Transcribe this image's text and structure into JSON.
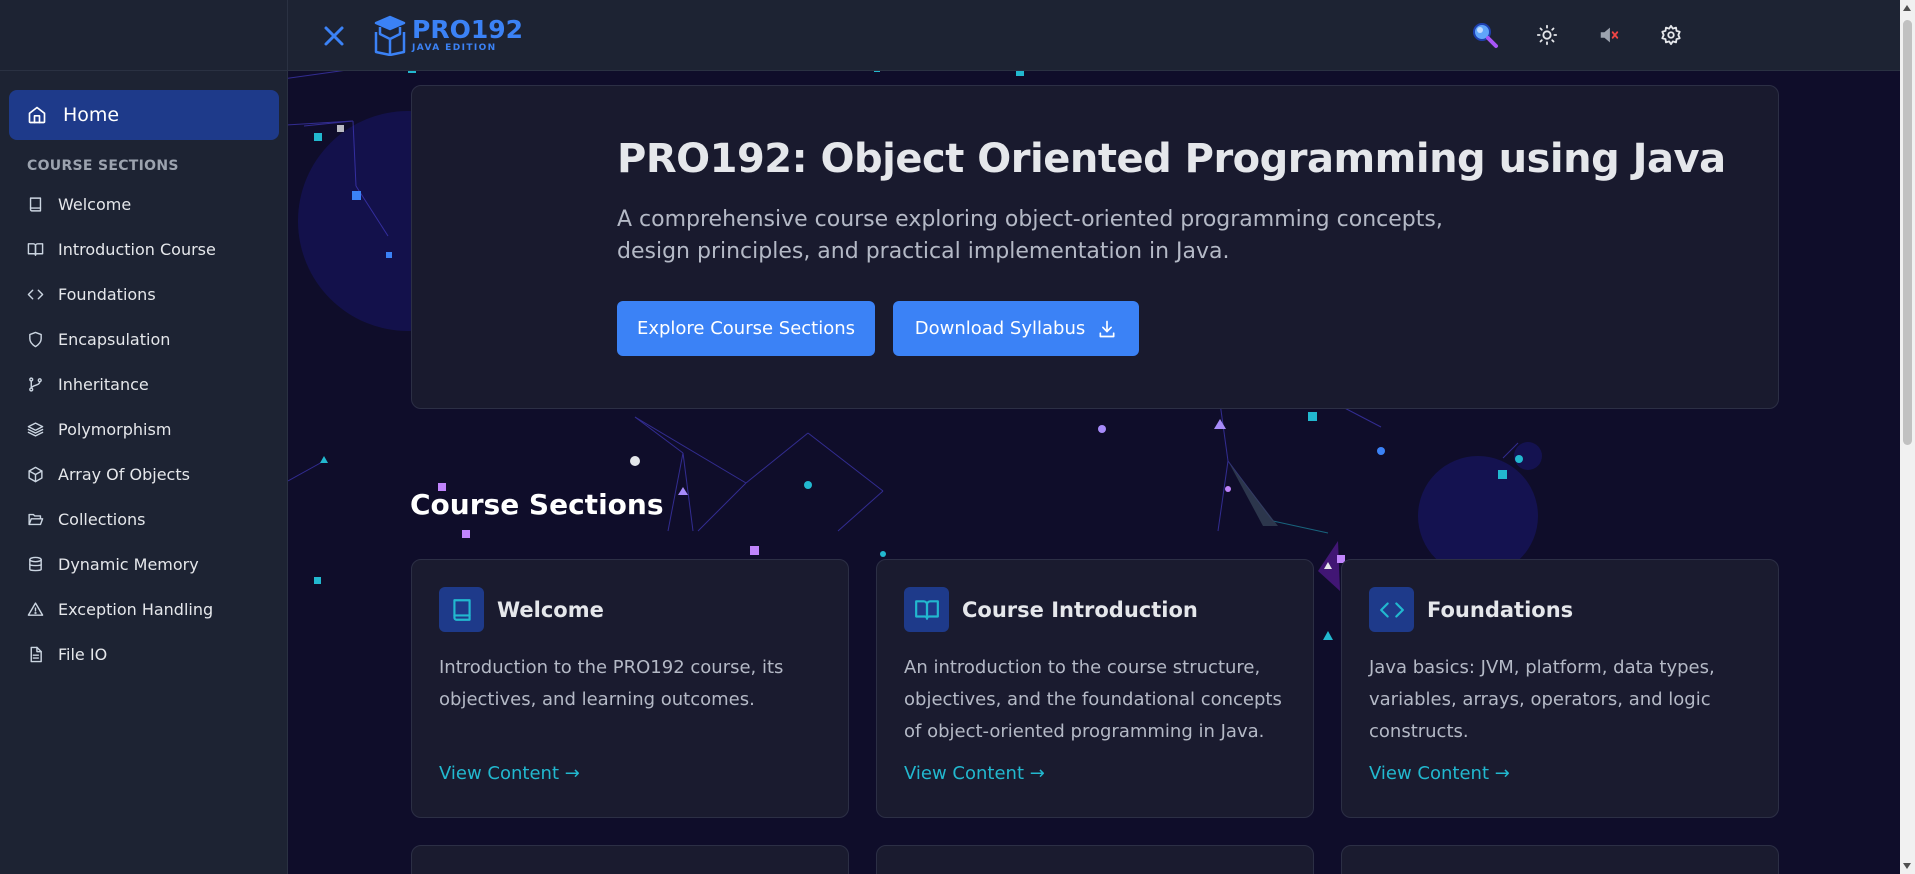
{
  "brand": {
    "name": "PRO192",
    "edition": "JAVA EDITION",
    "accent": "#3b82f6",
    "link_color": "#22b8cf"
  },
  "sidebar": {
    "home_label": "Home",
    "section_heading": "COURSE SECTIONS",
    "items": [
      {
        "label": "Welcome",
        "icon": "book-icon"
      },
      {
        "label": "Introduction Course",
        "icon": "open-book-icon"
      },
      {
        "label": "Foundations",
        "icon": "code-icon"
      },
      {
        "label": "Encapsulation",
        "icon": "shield-icon"
      },
      {
        "label": "Inheritance",
        "icon": "git-branch-icon"
      },
      {
        "label": "Polymorphism",
        "icon": "layers-icon"
      },
      {
        "label": "Array Of Objects",
        "icon": "cube-icon"
      },
      {
        "label": "Collections",
        "icon": "folder-open-icon"
      },
      {
        "label": "Dynamic Memory",
        "icon": "database-icon"
      },
      {
        "label": "Exception Handling",
        "icon": "warning-icon"
      },
      {
        "label": "File IO",
        "icon": "file-text-icon"
      }
    ]
  },
  "hero": {
    "title": "PRO192: Object Oriented Programming using Java",
    "description": "A comprehensive course exploring object-oriented programming concepts, design principles, and practical implementation in Java.",
    "explore_label": "Explore Course Sections",
    "download_label": "Download Syllabus"
  },
  "sections": {
    "title": "Course Sections",
    "cards": [
      {
        "title": "Welcome",
        "description": "Introduction to the PRO192 course, its objectives, and learning outcomes.",
        "link": "View Content →",
        "icon": "book-icon"
      },
      {
        "title": "Course Introduction",
        "description": "An introduction to the course structure, objectives, and the foundational concepts of object-oriented programming in Java.",
        "link": "View Content →",
        "icon": "open-book-icon"
      },
      {
        "title": "Foundations",
        "description": "Java basics: JVM, platform, data types, variables, arrays, operators, and logic constructs.",
        "link": "View Content →",
        "icon": "code-icon"
      }
    ]
  }
}
